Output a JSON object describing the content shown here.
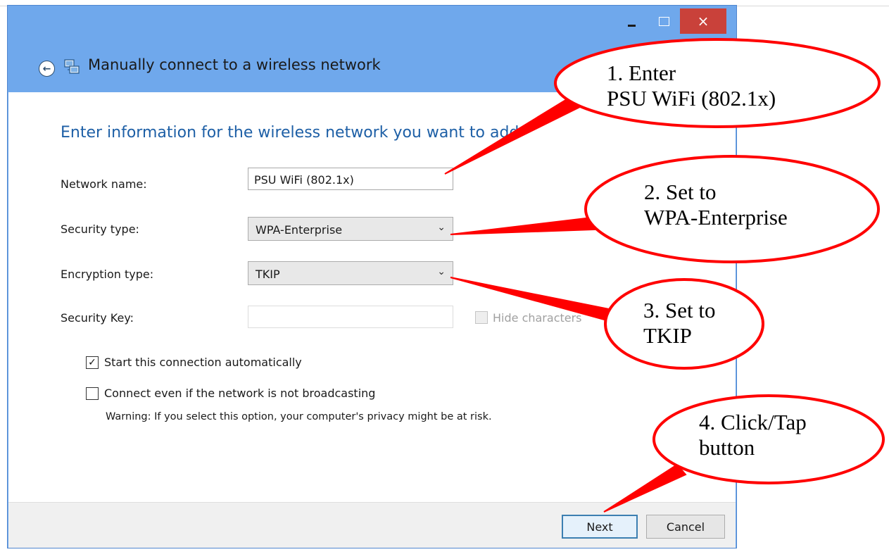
{
  "window": {
    "title": "Manually connect to a wireless network",
    "caption_buttons": {
      "minimize": "minimize",
      "maximize": "maximize",
      "close": "×"
    }
  },
  "form": {
    "heading": "Enter information for the wireless network you want to add",
    "network_name_label": "Network name:",
    "network_name_value": "PSU WiFi (802.1x)",
    "security_type_label": "Security type:",
    "security_type_value": "WPA-Enterprise",
    "encryption_type_label": "Encryption type:",
    "encryption_type_value": "TKIP",
    "security_key_label": "Security Key:",
    "security_key_value": "",
    "hide_characters_label": "Hide characters",
    "start_auto_label": "Start this connection automatically",
    "start_auto_checked": true,
    "connect_broadcast_label": "Connect even if the network is not broadcasting",
    "connect_broadcast_checked": false,
    "warning": "Warning: If you select this option, your computer's privacy might be at risk."
  },
  "buttons": {
    "next": "Next",
    "cancel": "Cancel"
  },
  "annotations": [
    {
      "line1": "1. Enter",
      "line2": "PSU WiFi (802.1x)"
    },
    {
      "line1": "2. Set to",
      "line2": "WPA-Enterprise"
    },
    {
      "line1": "3. Set to",
      "line2": "TKIP"
    },
    {
      "line1": "4. Click/Tap",
      "line2": "button"
    }
  ],
  "colors": {
    "window_frame": "#6fa8ec",
    "heading": "#1d5fa6",
    "close_button": "#c9413a",
    "annotation": "#ff0000"
  },
  "icons": [
    "back-arrow-icon",
    "network-icon",
    "chevron-down-icon",
    "checkmark-icon"
  ]
}
